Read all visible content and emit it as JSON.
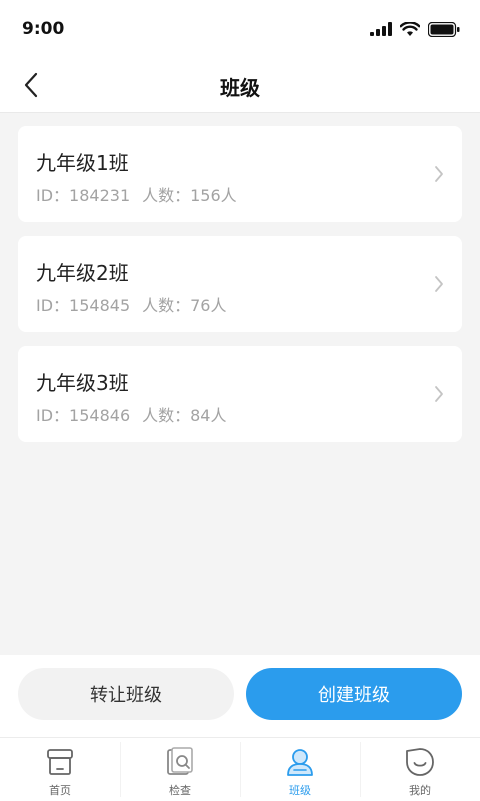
{
  "status_bar": {
    "time": "9:00"
  },
  "header": {
    "title": "班级"
  },
  "classes": [
    {
      "name": "九年级1班",
      "id_label": "ID：184231",
      "count_label": "人数：156人"
    },
    {
      "name": "九年级2班",
      "id_label": "ID：154845",
      "count_label": "人数：76人"
    },
    {
      "name": "九年级3班",
      "id_label": "ID：154846",
      "count_label": "人数：84人"
    }
  ],
  "actions": {
    "transfer_label": "转让班级",
    "create_label": "创建班级"
  },
  "tabs": [
    {
      "label": "首页",
      "icon": "home-box-icon",
      "active": false
    },
    {
      "label": "检查",
      "icon": "inspect-icon",
      "active": false
    },
    {
      "label": "班级",
      "icon": "class-person-icon",
      "active": true
    },
    {
      "label": "我的",
      "icon": "profile-icon",
      "active": false
    }
  ],
  "colors": {
    "accent": "#2b9ced",
    "background": "#f4f4f4",
    "muted_text": "#a3a3a3"
  }
}
